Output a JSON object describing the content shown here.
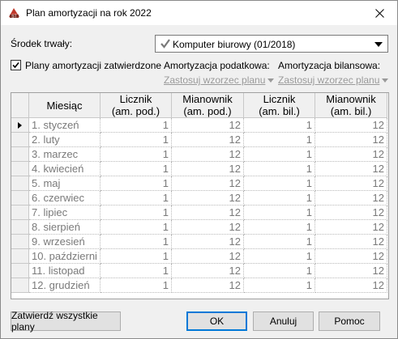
{
  "window": {
    "title": "Plan amortyzacji na rok 2022"
  },
  "asset": {
    "label": "Środek trwały:",
    "value": "Komputer biurowy (01/2018)"
  },
  "approved": {
    "label": "Plany amortyzacji zatwierdzone",
    "checked": true
  },
  "tax": {
    "label": "Amortyzacja podatkowa:",
    "link": "Zastosuj wzorzec planu"
  },
  "balance": {
    "label": "Amortyzacja bilansowa:",
    "link": "Zastosuj wzorzec planu"
  },
  "grid": {
    "headers": {
      "month": "Miesiąc",
      "tax_num_l1": "Licznik",
      "tax_num_l2": "(am. pod.)",
      "tax_den_l1": "Mianownik",
      "tax_den_l2": "(am. pod.)",
      "bal_num_l1": "Licznik",
      "bal_num_l2": "(am. bil.)",
      "bal_den_l1": "Mianownik",
      "bal_den_l2": "(am. bil.)"
    },
    "rows": [
      {
        "month": "1. styczeń",
        "tax_num": "1",
        "tax_den": "12",
        "bal_num": "1",
        "bal_den": "12"
      },
      {
        "month": "2. luty",
        "tax_num": "1",
        "tax_den": "12",
        "bal_num": "1",
        "bal_den": "12"
      },
      {
        "month": "3. marzec",
        "tax_num": "1",
        "tax_den": "12",
        "bal_num": "1",
        "bal_den": "12"
      },
      {
        "month": "4. kwiecień",
        "tax_num": "1",
        "tax_den": "12",
        "bal_num": "1",
        "bal_den": "12"
      },
      {
        "month": "5. maj",
        "tax_num": "1",
        "tax_den": "12",
        "bal_num": "1",
        "bal_den": "12"
      },
      {
        "month": "6. czerwiec",
        "tax_num": "1",
        "tax_den": "12",
        "bal_num": "1",
        "bal_den": "12"
      },
      {
        "month": "7. lipiec",
        "tax_num": "1",
        "tax_den": "12",
        "bal_num": "1",
        "bal_den": "12"
      },
      {
        "month": "8. sierpień",
        "tax_num": "1",
        "tax_den": "12",
        "bal_num": "1",
        "bal_den": "12"
      },
      {
        "month": "9. wrzesień",
        "tax_num": "1",
        "tax_den": "12",
        "bal_num": "1",
        "bal_den": "12"
      },
      {
        "month": "10. październi",
        "tax_num": "1",
        "tax_den": "12",
        "bal_num": "1",
        "bal_den": "12"
      },
      {
        "month": "11. listopad",
        "tax_num": "1",
        "tax_den": "12",
        "bal_num": "1",
        "bal_den": "12"
      },
      {
        "month": "12. grudzień",
        "tax_num": "1",
        "tax_den": "12",
        "bal_num": "1",
        "bal_den": "12"
      }
    ]
  },
  "buttons": {
    "approve_all": "Zatwierdź wszystkie plany",
    "ok": "OK",
    "cancel": "Anuluj",
    "help": "Pomoc"
  },
  "colors": {
    "accent": "#0078d7",
    "disabled_text": "#9a9a9a",
    "icon_red": "#c0392b"
  },
  "icons": {
    "app": "app-logo-icon",
    "close": "close-icon",
    "asset": "checkmark-icon"
  }
}
